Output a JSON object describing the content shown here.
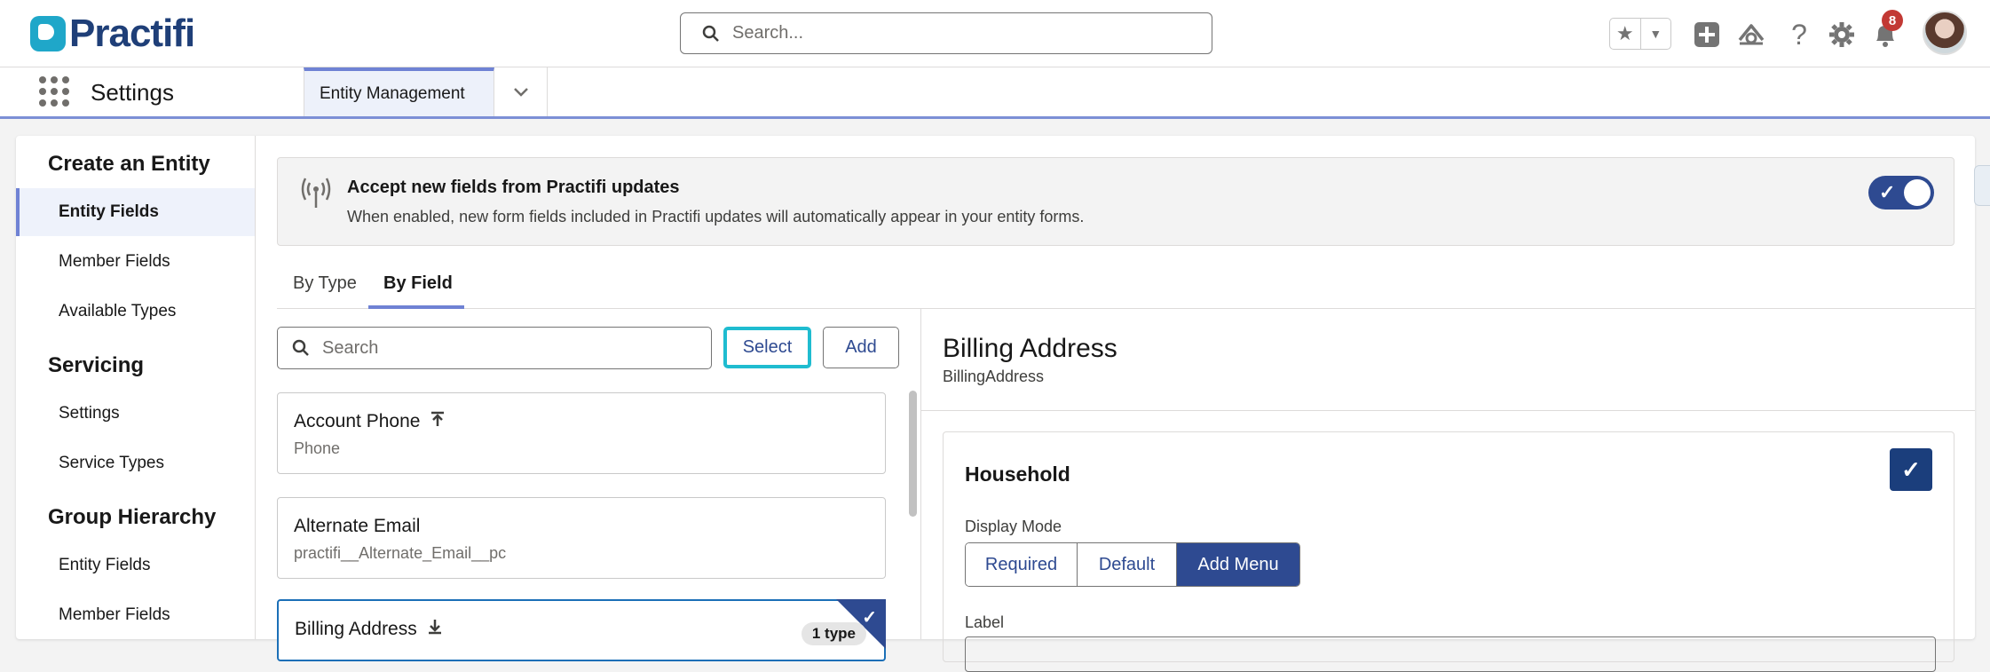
{
  "header": {
    "logo_text": "Practifi",
    "search_placeholder": "Search...",
    "notification_count": "8",
    "favorites_icon": "star-icon",
    "icons": [
      "add-icon",
      "trailhead-icon",
      "help-icon",
      "setup-gear-icon",
      "bell-icon"
    ]
  },
  "nav": {
    "app_name": "Settings",
    "tab_label": "Entity Management"
  },
  "sidebar": {
    "sections": [
      {
        "title": "Create an Entity",
        "items": [
          "Entity Fields",
          "Member Fields",
          "Available Types"
        ]
      },
      {
        "title": "Servicing",
        "items": [
          "Settings",
          "Service Types"
        ]
      },
      {
        "title": "Group Hierarchy",
        "items": [
          "Entity Fields",
          "Member Fields"
        ]
      }
    ],
    "active_item": "Entity Fields"
  },
  "banner": {
    "title": "Accept new fields from Practifi updates",
    "description": "When enabled, new form fields included in Practifi updates will automatically appear in your entity forms.",
    "toggle_on": true
  },
  "tabs": {
    "by_type": "By Type",
    "by_field": "By Field",
    "active": "By Field"
  },
  "list": {
    "search_placeholder": "Search",
    "select_label": "Select",
    "add_label": "Add",
    "cards": [
      {
        "title": "Account Phone",
        "subtitle": "Phone",
        "icon": "arrow-up-to-line-icon"
      },
      {
        "title": "Alternate Email",
        "subtitle": "practifi__Alternate_Email__pc",
        "icon": ""
      },
      {
        "title": "Billing Address",
        "subtitle": "",
        "icon": "arrow-down-icon",
        "badge": "1 type",
        "selected": true
      }
    ]
  },
  "detail": {
    "title": "Billing Address",
    "api_name": "BillingAddress",
    "type_card": {
      "title": "Household",
      "checked": true,
      "display_mode_label": "Display Mode",
      "modes": [
        "Required",
        "Default",
        "Add Menu"
      ],
      "active_mode": "Add Menu",
      "label_label": "Label"
    }
  },
  "colors": {
    "brand_navy": "#1f3f78",
    "brand_teal": "#1fa7c9",
    "accent": "#2e4a91",
    "focus": "#1fbcd0",
    "badge_red": "#c23934"
  }
}
